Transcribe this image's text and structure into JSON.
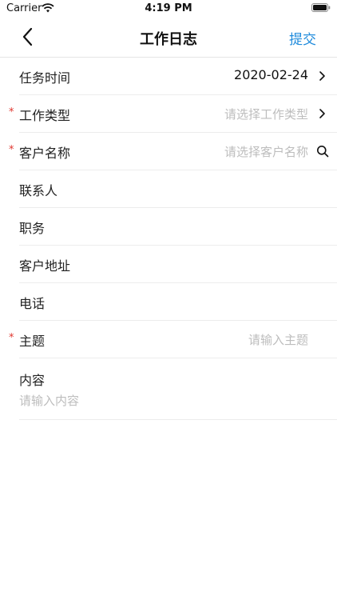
{
  "status_bar": {
    "carrier": "Carrier",
    "time": "4:19 PM"
  },
  "nav": {
    "title": "工作日志",
    "submit_label": "提交"
  },
  "form": {
    "task_time": {
      "label": "任务时间",
      "value": "2020-02-24"
    },
    "work_type": {
      "required_mark": "*",
      "label": "工作类型",
      "placeholder": "请选择工作类型"
    },
    "customer_name": {
      "required_mark": "*",
      "label": "客户名称",
      "placeholder": "请选择客户名称"
    },
    "contact": {
      "label": "联系人"
    },
    "position": {
      "label": "职务"
    },
    "customer_address": {
      "label": "客户地址"
    },
    "phone": {
      "label": "电话"
    },
    "subject": {
      "required_mark": "*",
      "label": "主题",
      "placeholder": "请输入主题"
    },
    "content": {
      "label": "内容",
      "placeholder": "请输入内容"
    }
  },
  "colors": {
    "accent": "#1f8bdc",
    "required": "#e0362f",
    "placeholder": "#bdbdbd"
  },
  "icons": [
    "back-chevron-icon",
    "wifi-icon",
    "battery-icon",
    "chevron-right-icon",
    "search-icon"
  ]
}
